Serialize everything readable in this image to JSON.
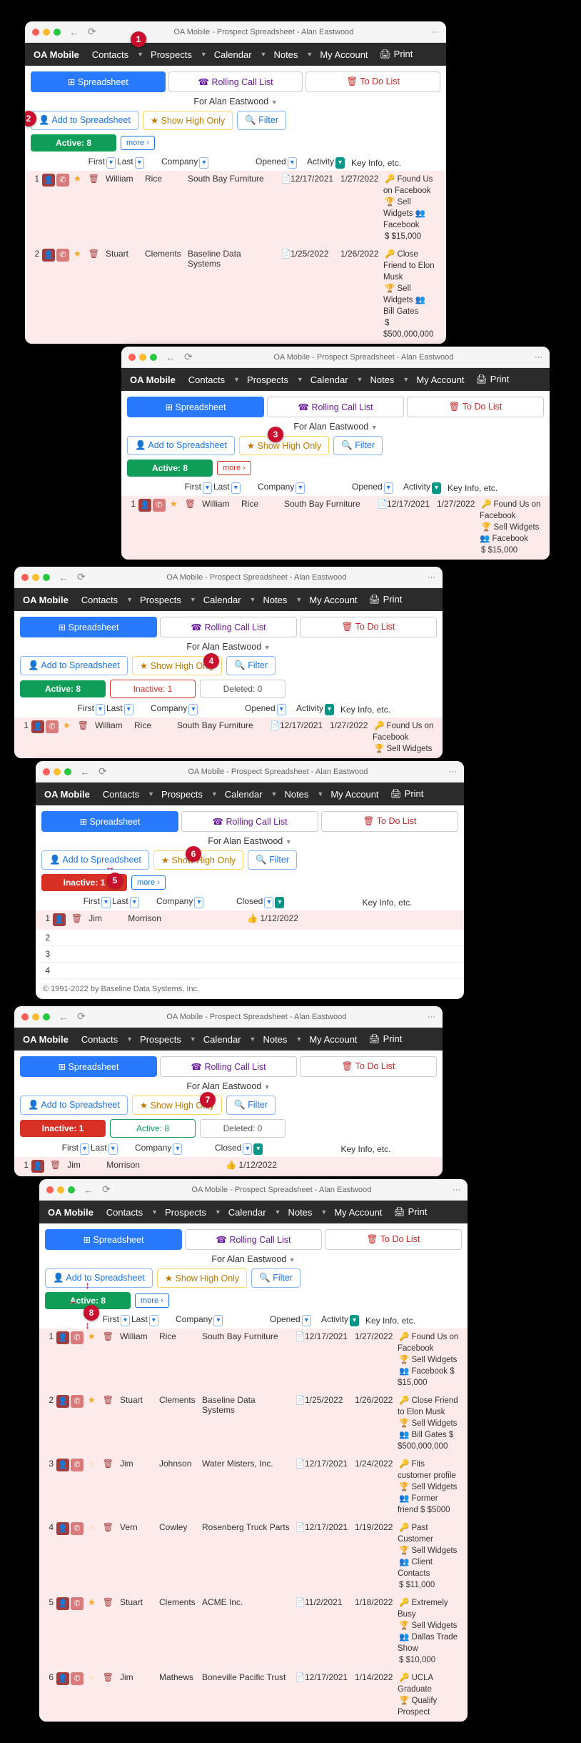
{
  "app": {
    "titlebar": "OA Mobile - Prospect Spreadsheet - Alan Eastwood",
    "logo": "OA Mobile",
    "menus": [
      "Contacts",
      "Prospects",
      "Calendar",
      "Notes",
      "My Account"
    ],
    "print": "Print",
    "tabs": {
      "spreadsheet": "Spreadsheet",
      "rolling": "Rolling Call List",
      "todo": "To Do List"
    },
    "for": "For Alan Eastwood",
    "toolbar": {
      "add": "Add to Spreadsheet",
      "high": "Show High Only",
      "filter": "Filter"
    },
    "more": "more ›"
  },
  "markers": [
    "1",
    "2",
    "3",
    "4",
    "5",
    "6",
    "7",
    "8"
  ],
  "f1": {
    "pill": "Active: 8",
    "cols": {
      "first": "First",
      "last": "Last",
      "company": "Company",
      "opened": "Opened",
      "activity": "Activity",
      "key": "Key Info, etc."
    },
    "rows": [
      {
        "n": "1",
        "first": "William",
        "last": "Rice",
        "co": "South Bay Furniture",
        "d1": "12/17/2021",
        "d2": "1/27/2022",
        "key": [
          "🔑 Found Us on Facebook",
          "🏆 Sell Widgets 👥 Facebook",
          "$ $15,000"
        ]
      },
      {
        "n": "2",
        "first": "Stuart",
        "last": "Clements",
        "co": "Baseline Data Systems",
        "d1": "1/25/2022",
        "d2": "1/26/2022",
        "key": [
          "🔑 Close Friend to Elon Musk",
          "🏆 Sell Widgets 👥 Bill Gates",
          "$ $500,000,000"
        ]
      }
    ]
  },
  "f2": {
    "pill": "Active: 8",
    "cols": {
      "first": "First",
      "last": "Last",
      "company": "Company",
      "opened": "Opened",
      "activity": "Activity",
      "key": "Key Info, etc."
    },
    "row1": {
      "n": "1",
      "first": "William",
      "last": "Rice",
      "co": "South Bay Furniture",
      "d1": "12/17/2021",
      "d2": "1/27/2022",
      "key": [
        "🔑 Found Us on Facebook",
        "🏆 Sell Widgets 👥 Facebook",
        "$ $15,000"
      ]
    }
  },
  "f3": {
    "pill": "Active: 8",
    "inactive": "Inactive: 1",
    "deleted": "Deleted: 0",
    "cols": {
      "first": "First",
      "last": "Last",
      "company": "Company",
      "opened": "Opened",
      "activity": "Activity",
      "key": "Key Info, etc."
    },
    "row1": {
      "n": "1",
      "first": "William",
      "last": "Rice",
      "co": "South Bay Furniture",
      "d1": "12/17/2021",
      "d2": "1/27/2022",
      "key": [
        "🔑 Found Us on Facebook",
        "🏆 Sell Widgets"
      ]
    }
  },
  "f4": {
    "pill": "Inactive: 1",
    "cols": {
      "first": "First",
      "last": "Last",
      "company": "Company",
      "closed": "Closed",
      "key": "Key Info, etc."
    },
    "row1": {
      "n": "1",
      "first": "Jim",
      "last": "Morrison",
      "closed": "1/12/2022"
    },
    "empty": [
      "2",
      "3",
      "4"
    ],
    "footer": "© 1991-2022 by Baseline Data Systems, Inc."
  },
  "f5": {
    "pill": "Inactive: 1",
    "active": "Active: 8",
    "deleted": "Deleted: 0",
    "cols": {
      "first": "First",
      "last": "Last",
      "company": "Company",
      "closed": "Closed",
      "key": "Key Info, etc."
    },
    "row1": {
      "n": "1",
      "first": "Jim",
      "last": "Morrison",
      "closed": "1/12/2022"
    }
  },
  "f6": {
    "pill": "Active: 8",
    "cols": {
      "first": "First",
      "last": "Last",
      "company": "Company",
      "opened": "Opened",
      "activity": "Activity",
      "key": "Key Info, etc."
    },
    "rows": [
      {
        "n": "1",
        "star": true,
        "first": "William",
        "last": "Rice",
        "co": "South Bay Furniture",
        "d1": "12/17/2021",
        "d2": "1/27/2022",
        "key": [
          "🔑 Found Us on Facebook",
          "🏆 Sell Widgets",
          "👥 Facebook $ $15,000"
        ]
      },
      {
        "n": "2",
        "star": true,
        "first": "Stuart",
        "last": "Clements",
        "co": "Baseline Data Systems",
        "d1": "1/25/2022",
        "d2": "1/26/2022",
        "key": [
          "🔑 Close Friend to Elon Musk",
          "🏆 Sell Widgets",
          "👥 Bill Gates $ $500,000,000"
        ]
      },
      {
        "n": "3",
        "star": false,
        "first": "Jim",
        "last": "Johnson",
        "co": "Water Misters, Inc.",
        "d1": "12/17/2021",
        "d2": "1/24/2022",
        "key": [
          "🔑 Fits customer profile",
          "🏆 Sell Widgets",
          "👥 Former friend $ $5000"
        ]
      },
      {
        "n": "4",
        "star": false,
        "first": "Vern",
        "last": "Cowley",
        "co": "Rosenberg Truck Parts",
        "d1": "12/17/2021",
        "d2": "1/19/2022",
        "key": [
          "🔑 Past Customer",
          "🏆 Sell Widgets",
          "👥 Client Contacts",
          "$ $11,000"
        ]
      },
      {
        "n": "5",
        "star": true,
        "first": "Stuart",
        "last": "Clements",
        "co": "ACME Inc.",
        "d1": "11/2/2021",
        "d2": "1/18/2022",
        "key": [
          "🔑 Extremely Busy",
          "🏆 Sell Widgets",
          "👥 Dallas Trade Show",
          "$ $10,000"
        ]
      },
      {
        "n": "6",
        "star": false,
        "first": "Jim",
        "last": "Mathews",
        "co": "Boneville Pacific Trust",
        "d1": "12/17/2021",
        "d2": "1/14/2022",
        "key": [
          "🔑 UCLA Graduate",
          "🏆 Qualify Prospect"
        ]
      }
    ]
  }
}
